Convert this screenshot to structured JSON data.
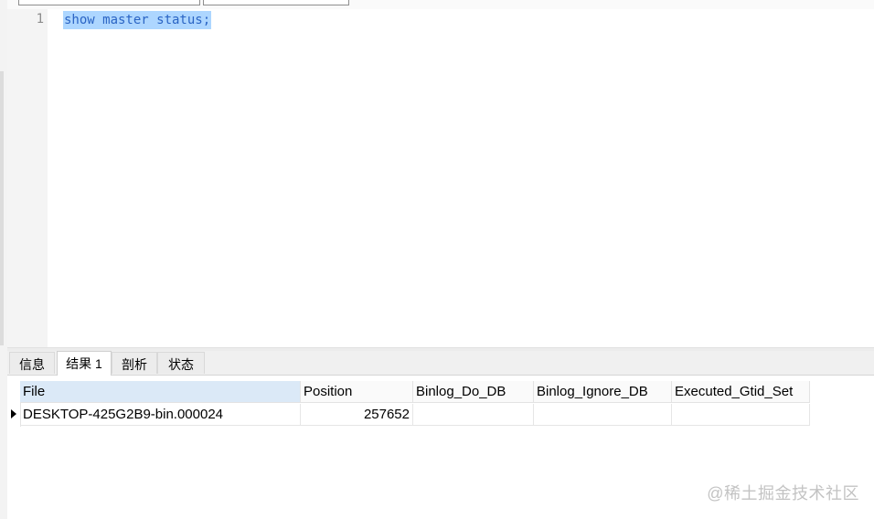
{
  "editor": {
    "line_number": "1",
    "code": "show master status;"
  },
  "tabs": [
    {
      "label": "信息"
    },
    {
      "label": "结果 1"
    },
    {
      "label": "剖析"
    },
    {
      "label": "状态"
    }
  ],
  "result_grid": {
    "columns": [
      "File",
      "Position",
      "Binlog_Do_DB",
      "Binlog_Ignore_DB",
      "Executed_Gtid_Set"
    ],
    "rows": [
      [
        "DESKTOP-425G2B9-bin.000024",
        "257652",
        "",
        "",
        ""
      ]
    ]
  },
  "watermark": "@稀土掘金技术社区",
  "colors": {
    "selection": "#add6ff",
    "keyword": "#2a64c4",
    "header_selected": "#dbe9f7"
  }
}
